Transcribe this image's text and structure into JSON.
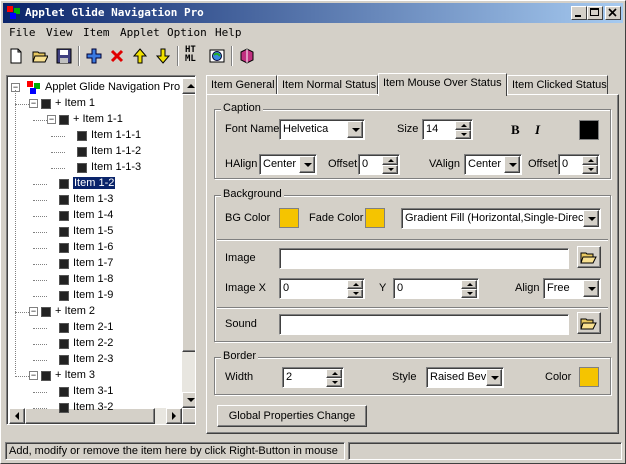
{
  "window": {
    "title": "Applet Glide Navigation Pro",
    "controls": [
      "minimize",
      "maximize",
      "close"
    ]
  },
  "menu": [
    "File",
    "View",
    "Item",
    "Applet",
    "Option",
    "Help"
  ],
  "toolbar": {
    "icons": [
      "new-icon",
      "open-icon",
      "save-icon",
      "add-icon",
      "delete-icon",
      "move-up-icon",
      "move-down-icon",
      "html-icon",
      "preview-icon",
      "help-book-icon"
    ],
    "html_label_top": "HT",
    "html_label_bottom": "ML"
  },
  "tree": {
    "root": "Applet Glide Navigation Pro",
    "items": [
      {
        "label": "+ Item 1",
        "level": 1
      },
      {
        "label": "+ Item 1-1",
        "level": 2
      },
      {
        "label": "Item 1-1-1",
        "level": 3
      },
      {
        "label": "Item 1-1-2",
        "level": 3
      },
      {
        "label": "Item 1-1-3",
        "level": 3
      },
      {
        "label": "Item 1-2",
        "level": 2,
        "selected": true
      },
      {
        "label": "Item 1-3",
        "level": 2
      },
      {
        "label": "Item 1-4",
        "level": 2
      },
      {
        "label": "Item 1-5",
        "level": 2
      },
      {
        "label": "Item 1-6",
        "level": 2
      },
      {
        "label": "Item 1-7",
        "level": 2
      },
      {
        "label": "Item 1-8",
        "level": 2
      },
      {
        "label": "Item 1-9",
        "level": 2
      },
      {
        "label": "+ Item 2",
        "level": 1
      },
      {
        "label": "Item 2-1",
        "level": 2
      },
      {
        "label": "Item 2-2",
        "level": 2
      },
      {
        "label": "Item 2-3",
        "level": 2
      },
      {
        "label": "+ Item 3",
        "level": 1
      },
      {
        "label": "Item 3-1",
        "level": 2
      },
      {
        "label": "Item 3-2",
        "level": 2
      }
    ]
  },
  "tabs": [
    "Item General",
    "Item Normal Status",
    "Item Mouse Over Status",
    "Item Clicked Status"
  ],
  "active_tab": 2,
  "caption": {
    "title": "Caption",
    "font_name_label": "Font Name",
    "font_name_value": "Helvetica",
    "size_label": "Size",
    "size_value": "14",
    "bold_label": "B",
    "italic_label": "I",
    "color": "#000000",
    "halign_label": "HAlign",
    "halign_value": "Center",
    "offset_label": "Offset",
    "offset_h_value": "0",
    "valign_label": "VAlign",
    "valign_value": "Center",
    "offset_v_value": "0"
  },
  "background": {
    "title": "Background",
    "bg_color_label": "BG Color",
    "bg_color": "#f5c400",
    "fade_color_label": "Fade Color",
    "fade_color": "#f5c400",
    "fill_value": "Gradient Fill (Horizontal,Single-Directio",
    "image_label": "Image",
    "image_value": "",
    "image_x_label": "Image X",
    "image_x_value": "0",
    "y_label": "Y",
    "y_value": "0",
    "align_label": "Align",
    "align_value": "Free",
    "sound_label": "Sound",
    "sound_value": ""
  },
  "border": {
    "title": "Border",
    "width_label": "Width",
    "width_value": "2",
    "style_label": "Style",
    "style_value": "Raised Bev",
    "color_label": "Color",
    "color": "#f5c400"
  },
  "global_button": "Global Properties Change",
  "status": {
    "message": "Add, modify or remove the item here by click Right-Button in mouse"
  }
}
